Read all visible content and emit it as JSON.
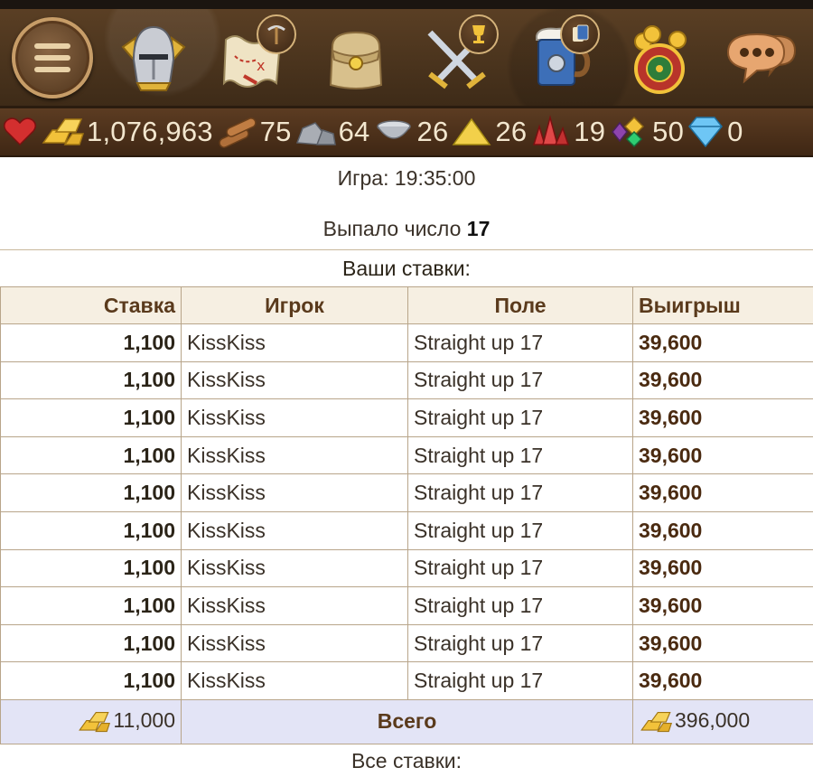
{
  "toolbar": {
    "items": [
      {
        "name": "menu-button",
        "icon": "menu-icon"
      },
      {
        "name": "knight-button",
        "icon": "knight-helmet-icon"
      },
      {
        "name": "map-button",
        "icon": "treasure-map-icon",
        "badge": "pickaxe-icon"
      },
      {
        "name": "bag-button",
        "icon": "backpack-icon"
      },
      {
        "name": "battle-button",
        "icon": "crossed-swords-icon",
        "badge": "trophy-icon"
      },
      {
        "name": "tavern-button",
        "icon": "beer-mug-icon",
        "badge": "cards-icon"
      },
      {
        "name": "casino-button",
        "icon": "roulette-icon"
      },
      {
        "name": "chat-button",
        "icon": "chat-bubble-icon"
      }
    ]
  },
  "resources": {
    "gold": "1,076,963",
    "wood": "75",
    "stone": "64",
    "iron": "26",
    "sulfur": "26",
    "crystals": "19",
    "gems": "50",
    "diamonds": "0"
  },
  "game": {
    "time_text": "Игра: 19:35:00",
    "rolled_label": "Выпало число",
    "rolled_number": "17"
  },
  "your_bets": {
    "title": "Ваши ставки:",
    "columns": [
      "Ставка",
      "Игрок",
      "Поле",
      "Выигрыш"
    ],
    "rows": [
      {
        "stake": "1,100",
        "player": "KissKiss",
        "field": "Straight up 17",
        "win": "39,600"
      },
      {
        "stake": "1,100",
        "player": "KissKiss",
        "field": "Straight up 17",
        "win": "39,600"
      },
      {
        "stake": "1,100",
        "player": "KissKiss",
        "field": "Straight up 17",
        "win": "39,600"
      },
      {
        "stake": "1,100",
        "player": "KissKiss",
        "field": "Straight up 17",
        "win": "39,600"
      },
      {
        "stake": "1,100",
        "player": "KissKiss",
        "field": "Straight up 17",
        "win": "39,600"
      },
      {
        "stake": "1,100",
        "player": "KissKiss",
        "field": "Straight up 17",
        "win": "39,600"
      },
      {
        "stake": "1,100",
        "player": "KissKiss",
        "field": "Straight up 17",
        "win": "39,600"
      },
      {
        "stake": "1,100",
        "player": "KissKiss",
        "field": "Straight up 17",
        "win": "39,600"
      },
      {
        "stake": "1,100",
        "player": "KissKiss",
        "field": "Straight up 17",
        "win": "39,600"
      },
      {
        "stake": "1,100",
        "player": "KissKiss",
        "field": "Straight up 17",
        "win": "39,600"
      }
    ],
    "total": {
      "stake": "11,000",
      "label": "Всего",
      "win": "396,000"
    }
  },
  "all_bets_title": "Все ставки:",
  "colors": {
    "toolbar_bg": "#4a3520",
    "resource_bar_bg": "#4a2f1b",
    "header_bg": "#f6efe2",
    "total_row_bg": "#e3e4f6",
    "header_text": "#5a3a1c"
  }
}
